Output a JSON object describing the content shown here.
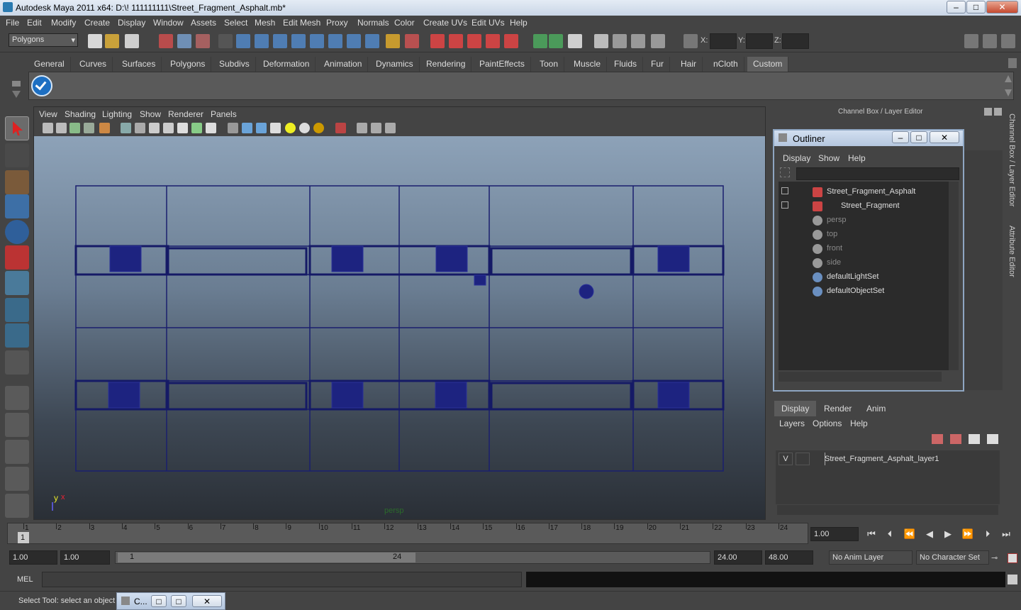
{
  "window": {
    "title": "Autodesk Maya 2011 x64: D:\\! 111111111\\Street_Fragment_Asphalt.mb*",
    "minimize": "–",
    "maximize": "□",
    "close": "✕"
  },
  "menubar": [
    "File",
    "Edit",
    "Modify",
    "Create",
    "Display",
    "Window",
    "Assets",
    "Select",
    "Mesh",
    "Edit Mesh",
    "Proxy",
    "Normals",
    "Color",
    "Create UVs",
    "Edit UVs",
    "Help"
  ],
  "status_line": {
    "mode": "Polygons",
    "x_label": "X:",
    "y_label": "Y:",
    "z_label": "Z:"
  },
  "shelf_tabs": [
    "General",
    "Curves",
    "Surfaces",
    "Polygons",
    "Subdivs",
    "Deformation",
    "Animation",
    "Dynamics",
    "Rendering",
    "PaintEffects",
    "Toon",
    "Muscle",
    "Fluids",
    "Fur",
    "Hair",
    "nCloth",
    "Custom"
  ],
  "shelf_active": "Custom",
  "viewport": {
    "menus": [
      "View",
      "Shading",
      "Lighting",
      "Show",
      "Renderer",
      "Panels"
    ],
    "camera_label": "persp",
    "axis_y": "y",
    "axis_x": "x"
  },
  "right_panel": {
    "header": "Channel Box / Layer Editor",
    "side_tab_channel": "Channel Box / Layer Editor",
    "side_tab_attr": "Attribute Editor"
  },
  "outliner": {
    "title": "Outliner",
    "menus": [
      "Display",
      "Show",
      "Help"
    ],
    "items": [
      {
        "label": "Street_Fragment_Asphalt",
        "icon": "mesh-icon",
        "dim": false
      },
      {
        "label": "Street_Fragment",
        "icon": "mesh-icon",
        "dim": false
      },
      {
        "label": "persp",
        "icon": "camera-icon",
        "dim": true
      },
      {
        "label": "top",
        "icon": "camera-icon",
        "dim": true
      },
      {
        "label": "front",
        "icon": "camera-icon",
        "dim": true
      },
      {
        "label": "side",
        "icon": "camera-icon",
        "dim": true
      },
      {
        "label": "defaultLightSet",
        "icon": "set-icon",
        "dim": false
      },
      {
        "label": "defaultObjectSet",
        "icon": "set-icon",
        "dim": false
      }
    ]
  },
  "layer_editor": {
    "tabs": [
      "Display",
      "Render",
      "Anim"
    ],
    "menus": [
      "Layers",
      "Options",
      "Help"
    ],
    "layer": {
      "visible": "V",
      "name": "Street_Fragment_Asphalt_layer1"
    }
  },
  "timeline": {
    "ticks": [
      1,
      2,
      3,
      4,
      5,
      6,
      7,
      8,
      9,
      10,
      11,
      12,
      13,
      14,
      15,
      16,
      17,
      18,
      19,
      20,
      21,
      22,
      23,
      24
    ],
    "current_frame_label": "1",
    "current_time": "1.00"
  },
  "range": {
    "start": "1.00",
    "playback_start": "1.00",
    "slider_start": "1",
    "slider_end": "24",
    "playback_end": "24.00",
    "end": "48.00",
    "anim_layer": "No Anim Layer",
    "character_set": "No Character Set"
  },
  "command_line": {
    "label": "MEL"
  },
  "help_line": {
    "text": "Select Tool: select an object",
    "taskbar_item": "C..."
  }
}
